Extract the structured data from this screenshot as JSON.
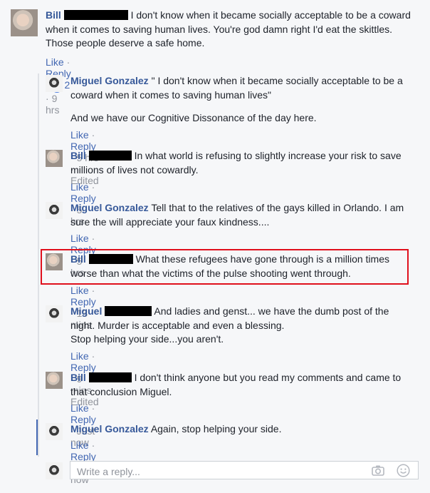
{
  "comments": [
    {
      "author": "Bill",
      "text": "I don't know when it became socially acceptable to be a coward when it comes to saving human lives. You're god damn right I'd eat the skittles. Those people deserve a safe home.",
      "like": "Like",
      "reply": "Reply",
      "reactions_count": "2",
      "time": "9 hrs"
    },
    {
      "author": "Miguel Gonzalez",
      "text_line1": "\" I don't know when it became socially acceptable to be a coward when it comes to saving human lives\"",
      "text_line2": "And we have our Cognitive Dissonance of the day here.",
      "like": "Like",
      "reply": "Reply",
      "time": "5 hrs",
      "edited": "Edited"
    },
    {
      "author": "Bill",
      "text": "In what world is refusing to slightly increase your risk to save millions of lives not cowardly.",
      "like": "Like",
      "reply": "Reply",
      "time": "5 hrs"
    },
    {
      "author": "Miguel Gonzalez",
      "text": "Tell that to the relatives of the gays killed in Orlando. I am sure the will appreciate your faux kindness....",
      "like": "Like",
      "reply": "Reply",
      "time": "5 hrs"
    },
    {
      "author": "Bill",
      "text": "What these refugees have gone through is a million times worse than what the victims of the pulse shooting went through.",
      "like": "Like",
      "reply": "Reply",
      "time": "13 mins"
    },
    {
      "author": "Miguel",
      "text_line1": "And ladies and genst... we have the dumb post of the night. Murder is acceptable and even a blessing.",
      "text_line2": "Stop helping your side...you aren't.",
      "like": "Like",
      "reply": "Reply",
      "time": "9 mins",
      "edited": "Edited"
    },
    {
      "author": "Bill",
      "text": "I don't think anyone but you read my comments and came to that conclusion Miguel.",
      "like": "Like",
      "reply": "Reply",
      "time": "Just now"
    },
    {
      "author": "Miguel Gonzalez",
      "text": "Again, stop helping your side.",
      "like": "Like",
      "reply": "Reply",
      "time": "Just now"
    }
  ],
  "reply_box": {
    "placeholder": "Write a reply..."
  },
  "icons": {
    "like_reaction": "thumbs-up-icon",
    "camera": "camera-icon",
    "emoji": "smile-icon"
  },
  "colors": {
    "link": "#4267b2",
    "name": "#365899",
    "highlight": "#e0101d"
  }
}
